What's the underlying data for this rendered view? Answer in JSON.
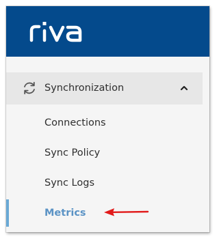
{
  "header": {
    "logo_text": "riva",
    "logo_icon": "riva-logo",
    "background_color": "#044a8c"
  },
  "sidebar": {
    "section": {
      "label": "Synchronization",
      "icon": "sync-icon",
      "expanded": true,
      "caret_icon": "chevron-up-icon"
    },
    "items": [
      {
        "label": "Connections",
        "active": false
      },
      {
        "label": "Sync Policy",
        "active": false
      },
      {
        "label": "Sync Logs",
        "active": false
      },
      {
        "label": "Metrics",
        "active": true
      }
    ],
    "active_color": "#5b93c5"
  },
  "annotation": {
    "icon": "red-arrow-icon",
    "color": "#e11b1b"
  }
}
